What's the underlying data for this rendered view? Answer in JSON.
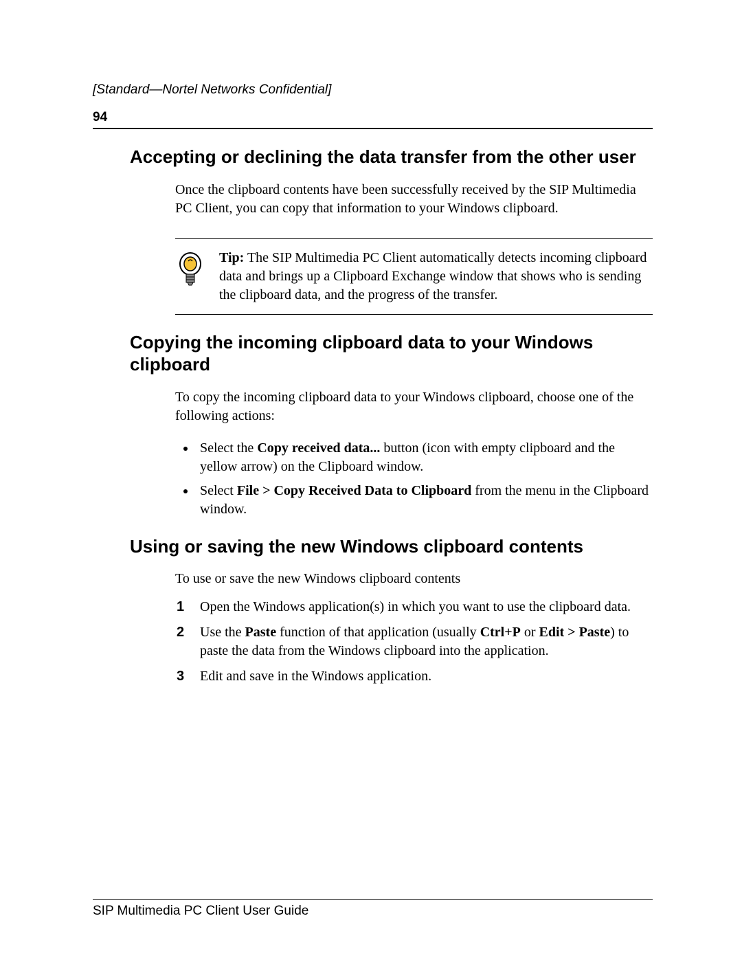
{
  "header": {
    "classification": "[Standard—Nortel Networks Confidential]",
    "page_number": "94"
  },
  "section1": {
    "heading": "Accepting or declining the data transfer from the other user",
    "para": "Once the clipboard contents have been successfully received by the SIP Multimedia PC Client, you can copy that information to your Windows clipboard."
  },
  "tip": {
    "label": "Tip:",
    "text": " The SIP Multimedia PC Client automatically detects incoming clipboard data and brings up a Clipboard Exchange window that shows who is sending the clipboard data, and the progress of the transfer."
  },
  "section2": {
    "heading": "Copying the incoming clipboard data to your Windows clipboard",
    "intro": "To copy the incoming clipboard data to your Windows clipboard, choose one of the following actions:",
    "bullets": {
      "b1_pre": "Select the ",
      "b1_bold": "Copy received data...",
      "b1_post": " button (icon with empty clipboard and the yellow arrow) on the Clipboard window.",
      "b2_pre": "Select ",
      "b2_bold": "File > Copy Received Data to Clipboard",
      "b2_post": " from the menu in the Clipboard window."
    }
  },
  "section3": {
    "heading": "Using or saving the new Windows clipboard contents",
    "intro": "To use or save the new Windows clipboard contents",
    "steps": {
      "s1": "Open the Windows application(s) in which you want to use the clipboard data.",
      "s2_a": "Use the ",
      "s2_b1": "Paste",
      "s2_b": " function of that application (usually ",
      "s2_b2": "Ctrl+P",
      "s2_c": " or ",
      "s2_b3": "Edit > Paste",
      "s2_d": ") to paste the data from the Windows clipboard into the application.",
      "s3": "Edit and save in the Windows application."
    }
  },
  "footer": {
    "text": "SIP Multimedia PC Client User Guide"
  }
}
